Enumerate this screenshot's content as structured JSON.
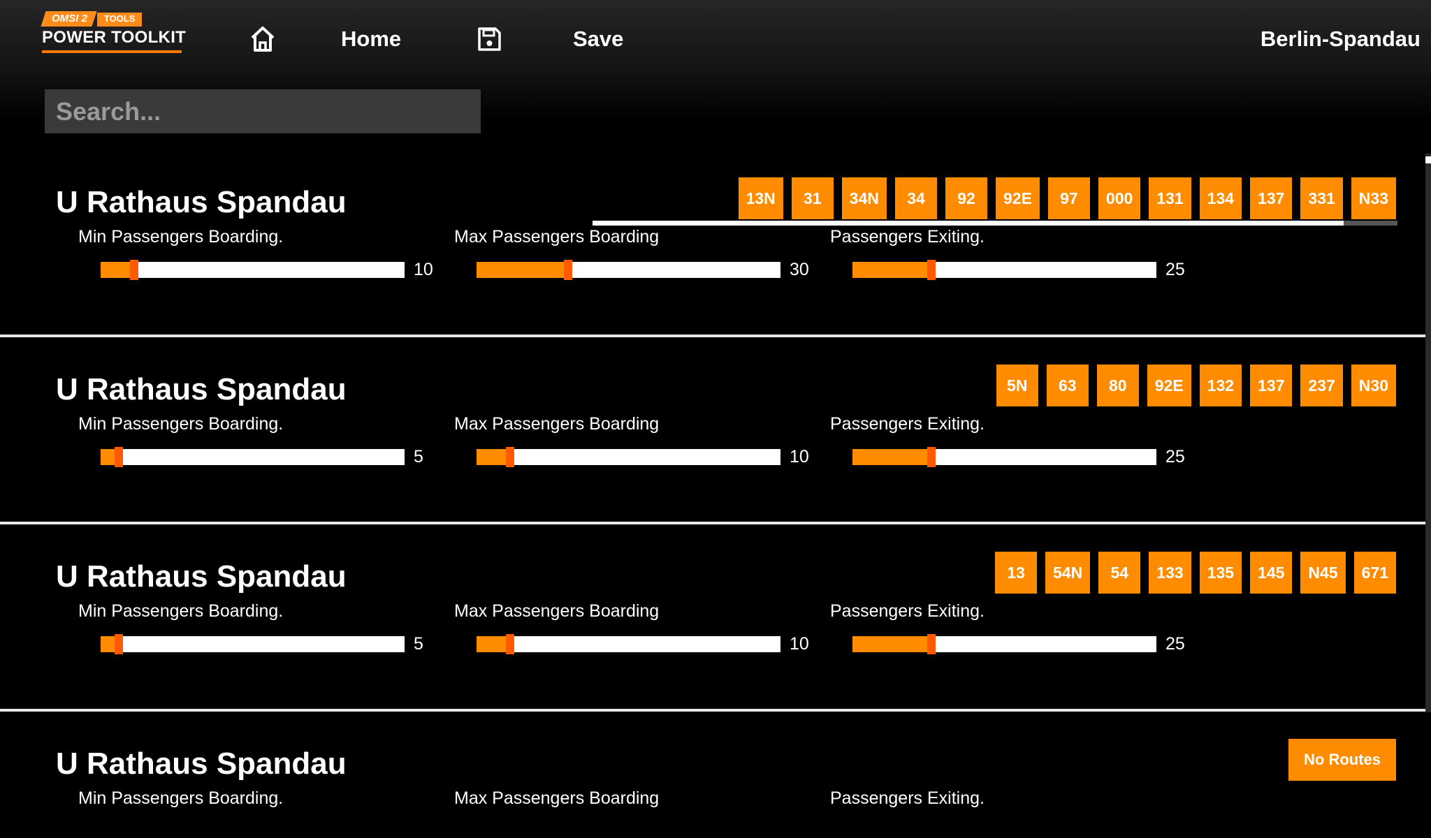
{
  "app": {
    "logo_omsi": "OMSI 2",
    "logo_tools": "TOOLS",
    "logo_title": "POWER TOOLKIT"
  },
  "nav": {
    "home_label": "Home",
    "save_label": "Save",
    "map_name": "Berlin-Spandau"
  },
  "search": {
    "placeholder": "Search..."
  },
  "colors": {
    "accent": "#ff8c00",
    "thumb": "#ff5a00",
    "track": "#ffffff"
  },
  "stops": [
    {
      "name": "U Rathaus Spandau",
      "routes": [
        "13N",
        "31",
        "34N",
        "34",
        "92",
        "92E",
        "97",
        "000",
        "131",
        "134",
        "137",
        "331",
        "N33"
      ],
      "sliders": [
        {
          "label": "Min Passengers Boarding.",
          "value": "10",
          "fraction": 0.11
        },
        {
          "label": "Max Passengers Boarding",
          "value": "30",
          "fraction": 0.3
        },
        {
          "label": "Passengers Exiting.",
          "value": "25",
          "fraction": 0.26
        }
      ]
    },
    {
      "name": "U Rathaus Spandau",
      "routes": [
        "5N",
        "63",
        "80",
        "92E",
        "132",
        "137",
        "237",
        "N30"
      ],
      "sliders": [
        {
          "label": "Min Passengers Boarding.",
          "value": "5",
          "fraction": 0.06
        },
        {
          "label": "Max Passengers Boarding",
          "value": "10",
          "fraction": 0.11
        },
        {
          "label": "Passengers Exiting.",
          "value": "25",
          "fraction": 0.26
        }
      ]
    },
    {
      "name": "U Rathaus Spandau",
      "routes": [
        "13",
        "54N",
        "54",
        "133",
        "135",
        "145",
        "N45",
        "671"
      ],
      "sliders": [
        {
          "label": "Min Passengers Boarding.",
          "value": "5",
          "fraction": 0.06
        },
        {
          "label": "Max Passengers Boarding",
          "value": "10",
          "fraction": 0.11
        },
        {
          "label": "Passengers Exiting.",
          "value": "25",
          "fraction": 0.26
        }
      ]
    },
    {
      "name": "U Rathaus Spandau",
      "routes": [
        "No Routes"
      ],
      "sliders": [
        {
          "label": "Min Passengers Boarding."
        },
        {
          "label": "Max Passengers Boarding"
        },
        {
          "label": "Passengers Exiting."
        }
      ]
    }
  ]
}
